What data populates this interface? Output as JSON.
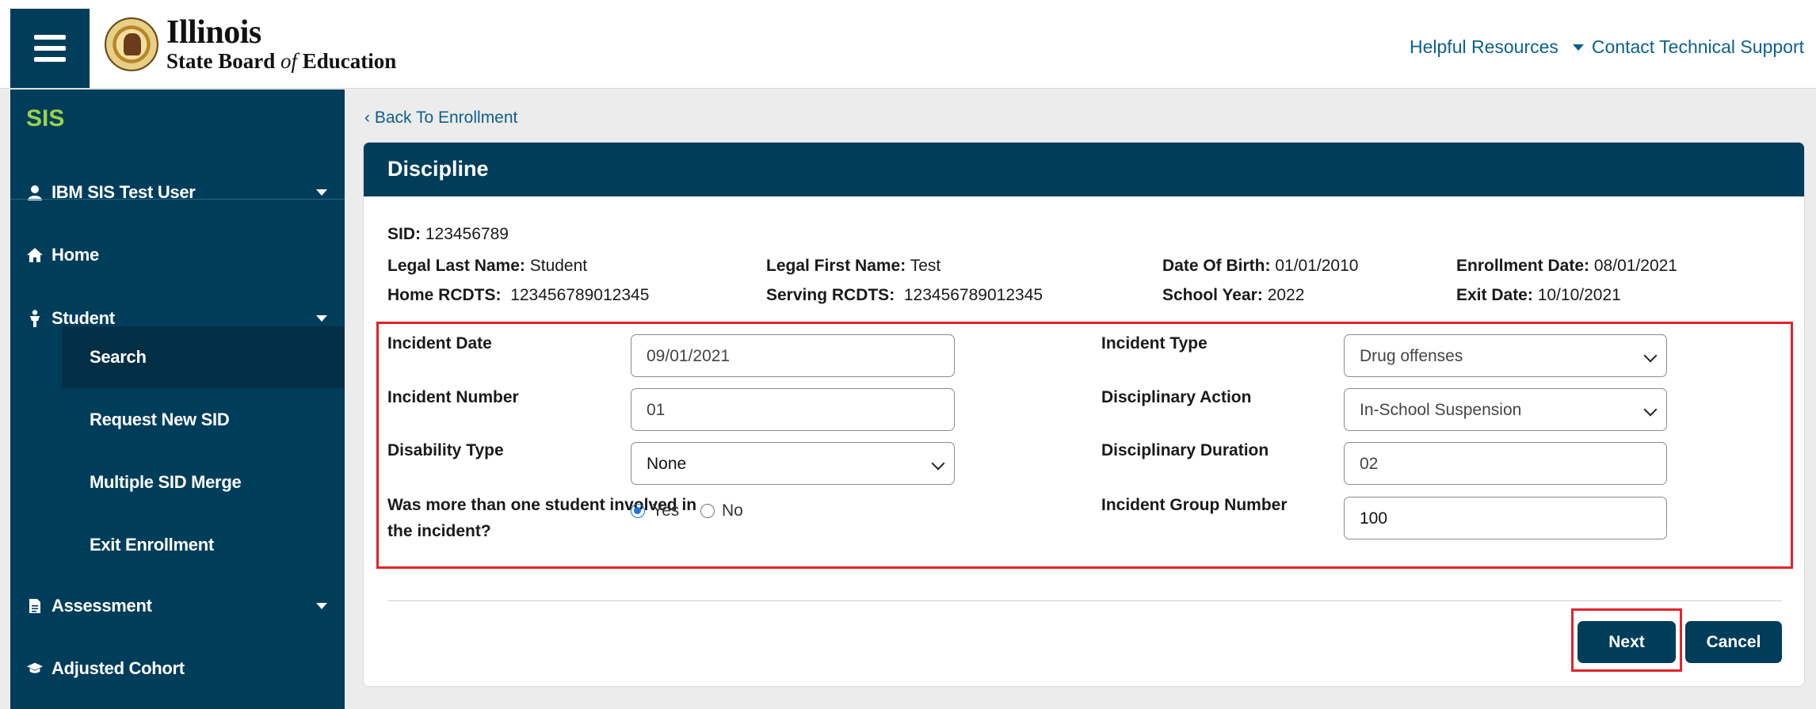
{
  "header": {
    "logo_line1": "Illinois",
    "logo_line2_a": "State Board ",
    "logo_line2_of": "of",
    "logo_line2_b": " Education",
    "helpful_resources": "Helpful Resources",
    "contact_support": "Contact Technical Support"
  },
  "sidebar": {
    "app_title": "SIS",
    "user": "IBM SIS Test User",
    "home": "Home",
    "student": "Student",
    "sub_items": [
      "Search",
      "Request New SID",
      "Multiple SID Merge",
      "Exit Enrollment"
    ],
    "assessment": "Assessment",
    "adjusted_cohort": "Adjusted Cohort"
  },
  "nav": {
    "back": "Back To Enrollment"
  },
  "card": {
    "title": "Discipline",
    "sid_label": "SID:",
    "sid": "123456789",
    "legal_last_name_label": "Legal Last Name:",
    "legal_last_name": "Student",
    "home_rcdts_label": "Home RCDTS:",
    "home_rcdts": "123456789012345",
    "legal_first_name_label": "Legal First Name:",
    "legal_first_name": "Test",
    "serving_rcdts_label": "Serving RCDTS:",
    "serving_rcdts": "123456789012345",
    "dob_label": "Date Of Birth:",
    "dob": "01/01/2010",
    "school_year_label": "School Year:",
    "school_year": "2022",
    "enrollment_date_label": "Enrollment Date:",
    "enrollment_date": "08/01/2021",
    "exit_date_label": "Exit Date:",
    "exit_date": "10/10/2021"
  },
  "form": {
    "incident_date_label": "Incident Date",
    "incident_date": "09/01/2021",
    "incident_number_label": "Incident Number",
    "incident_number": "01",
    "disability_type_label": "Disability Type",
    "disability_type": "None",
    "multi_student_label_1": "Was more than one student involved in",
    "multi_student_label_2": "the incident?",
    "yes": "Yes",
    "no": "No",
    "multi_student_selected": "Yes",
    "incident_type_label": "Incident Type",
    "incident_type": "Drug offenses",
    "disciplinary_action_label": "Disciplinary Action",
    "disciplinary_action": "In-School Suspension",
    "disciplinary_duration_label": "Disciplinary Duration",
    "disciplinary_duration": "02",
    "incident_group_label": "Incident Group Number",
    "incident_group": "100"
  },
  "buttons": {
    "next": "Next",
    "cancel": "Cancel"
  }
}
